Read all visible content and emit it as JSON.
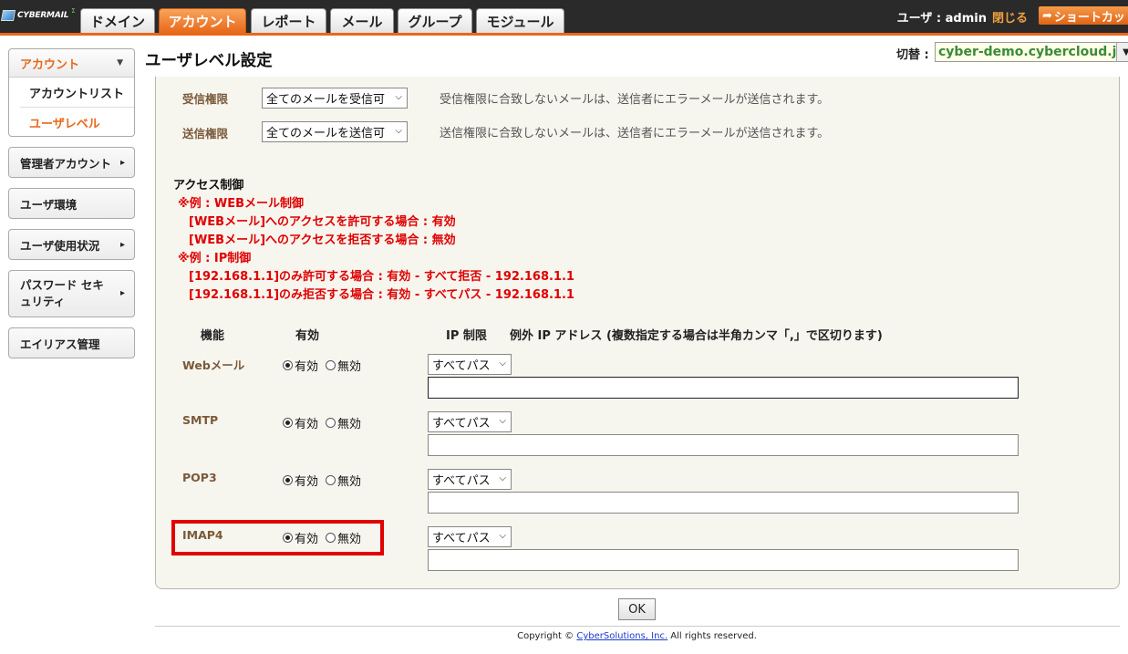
{
  "header": {
    "logo_text": "CYBERMAIL",
    "logo_sup": "Σ",
    "tabs": [
      "ドメイン",
      "アカウント",
      "レポート",
      "メール",
      "グループ",
      "モジュール"
    ],
    "active_tab": "アカウント",
    "user_text": "ユーザ : admin",
    "close_label": "閉じる",
    "shortcut_label": "ショートカット"
  },
  "sidebar": {
    "account_head": "アカウント",
    "account_list": "アカウントリスト",
    "user_level": "ユーザレベル",
    "admin_account": "管理者アカウント",
    "user_env": "ユーザ環境",
    "user_usage": "ユーザ使用状況",
    "password_security": "パスワード セキュリティ",
    "alias": "エイリアス管理"
  },
  "page": {
    "title": "ユーザレベル設定",
    "switch_label": "切替 :",
    "switch_value": "cyber-demo.cybercloud.jp"
  },
  "permissions": {
    "receive_label": "受信権限",
    "receive_value": "全てのメールを受信可",
    "receive_note": "受信権限に合致しないメールは、送信者にエラーメールが送信されます。",
    "send_label": "送信権限",
    "send_value": "全てのメールを送信可",
    "send_note": "送信権限に合致しないメールは、送信者にエラーメールが送信されます。"
  },
  "access": {
    "title": "アクセス制御",
    "ex1": "※例 : WEBメール制御",
    "ex1a": "[WEBメール]へのアクセスを許可する場合 :  有効",
    "ex1b": "[WEBメール]へのアクセスを拒否する場合 :  無効",
    "ex2": "※例 : IP制御",
    "ex2a": "[192.168.1.1]のみ許可する場合 :  有効 - すべて拒否 - 192.168.1.1",
    "ex2b": "[192.168.1.1]のみ拒否する場合 :  有効 - すべてパス - 192.168.1.1"
  },
  "table": {
    "col_function": "機能",
    "col_enabled": "有効",
    "col_ip": "IP 制限",
    "col_exception": "例外 IP アドレス (複数指定する場合は半角カンマ「,」で区切ります)",
    "on_label": "有効",
    "off_label": "無効",
    "rows": [
      {
        "name": "Webメール",
        "enabled": true,
        "ip_mode": "すべてパス",
        "exception": ""
      },
      {
        "name": "SMTP",
        "enabled": true,
        "ip_mode": "すべてパス",
        "exception": ""
      },
      {
        "name": "POP3",
        "enabled": true,
        "ip_mode": "すべてパス",
        "exception": ""
      },
      {
        "name": "IMAP4",
        "enabled": true,
        "ip_mode": "すべてパス",
        "exception": ""
      }
    ]
  },
  "ok_label": "OK",
  "footer": {
    "prefix": "Copyright © ",
    "link": "CyberSolutions, Inc.",
    "suffix": " All rights reserved."
  }
}
